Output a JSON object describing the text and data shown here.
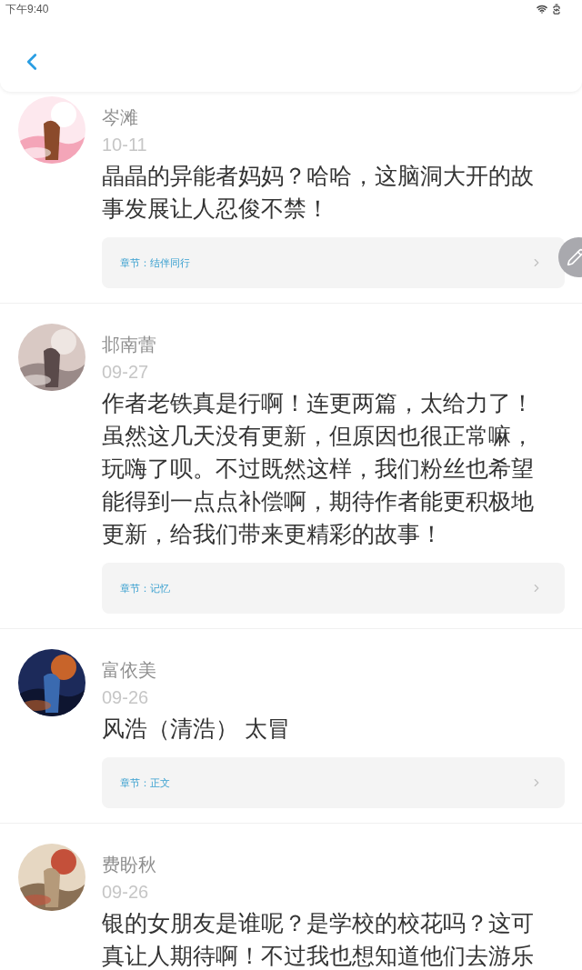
{
  "status_bar": {
    "time": "下午9:40"
  },
  "comments": [
    {
      "name": "岑滩",
      "date": "10-11",
      "body": "晶晶的异能者妈妈？哈哈，这脑洞大开的故事发展让人忍俊不禁！",
      "chapter": "章节：结伴同行"
    },
    {
      "name": "邶南蕾",
      "date": "09-27",
      "body": "作者老铁真是行啊！连更两篇，太给力了！虽然这几天没有更新，但原因也很正常嘛，玩嗨了呗。不过既然这样，我们粉丝也希望能得到一点点补偿啊，期待作者能更积极地更新，给我们带来更精彩的故事！",
      "chapter": "章节：记忆"
    },
    {
      "name": "富依美",
      "date": "09-26",
      "body": "风浩（清浩） 太冒",
      "chapter": "章节：正文"
    },
    {
      "name": "费盼秋",
      "date": "09-26",
      "body": "银的女朋友是谁呢？是学校的校花吗？这可真让人期待啊！不过我也想知道他们去游乐"
    }
  ]
}
